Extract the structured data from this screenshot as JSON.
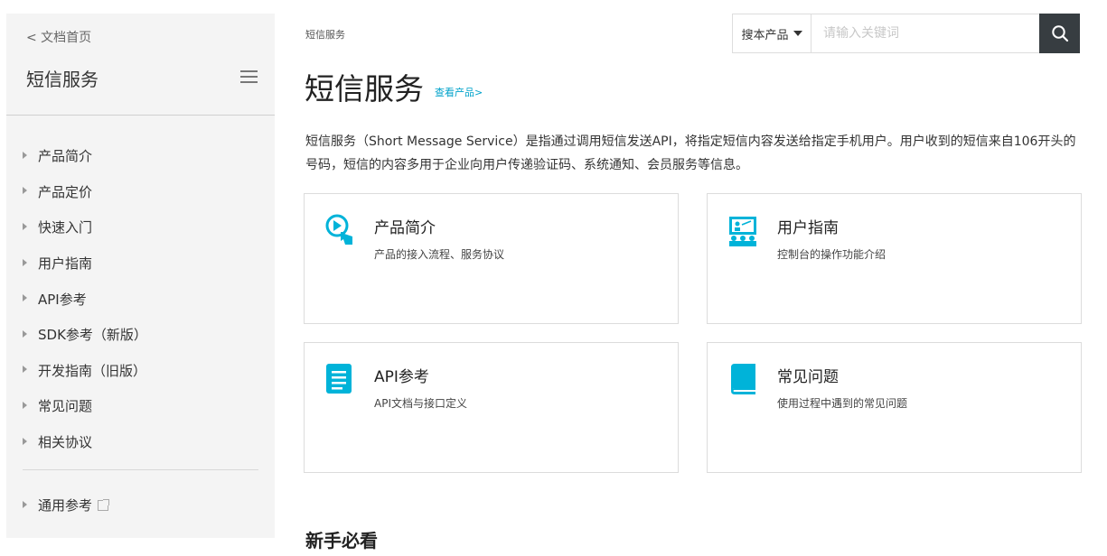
{
  "sidebar": {
    "back_label": "< 文档首页",
    "title": "短信服务",
    "items": [
      {
        "label": "产品简介"
      },
      {
        "label": "产品定价"
      },
      {
        "label": "快速入门"
      },
      {
        "label": "用户指南"
      },
      {
        "label": "API参考"
      },
      {
        "label": "SDK参考（新版）"
      },
      {
        "label": "开发指南（旧版）"
      },
      {
        "label": "常见问题"
      },
      {
        "label": "相关协议"
      }
    ],
    "bottom_item": {
      "label": "通用参考",
      "icon": "external-link-icon"
    }
  },
  "breadcrumb": "短信服务",
  "search": {
    "scope_label": "搜本产品",
    "placeholder": "请输入关键词",
    "button_icon": "search-icon"
  },
  "page": {
    "title": "短信服务",
    "view_product_link": "查看产品>",
    "intro": "短信服务（Short Message Service）是指通过调用短信发送API，将指定短信内容发送给指定手机用户。用户收到的短信来自106开头的号码，短信的内容多用于企业向用户传递验证码、系统通知、会员服务等信息。"
  },
  "cards": [
    {
      "title": "产品简介",
      "desc": "产品的接入流程、服务协议",
      "icon": "play-touch-icon"
    },
    {
      "title": "用户指南",
      "desc": "控制台的操作功能介绍",
      "icon": "presentation-audience-icon"
    },
    {
      "title": "API参考",
      "desc": "API文档与接口定义",
      "icon": "document-icon"
    },
    {
      "title": "常见问题",
      "desc": "使用过程中遇到的常见问题",
      "icon": "book-icon"
    }
  ],
  "section": {
    "title": "新手必看"
  },
  "colors": {
    "accent": "#00a2ca",
    "icon": "#00b3d9",
    "sidebar_bg": "#f4f4f4",
    "search_button": "#373d41"
  }
}
